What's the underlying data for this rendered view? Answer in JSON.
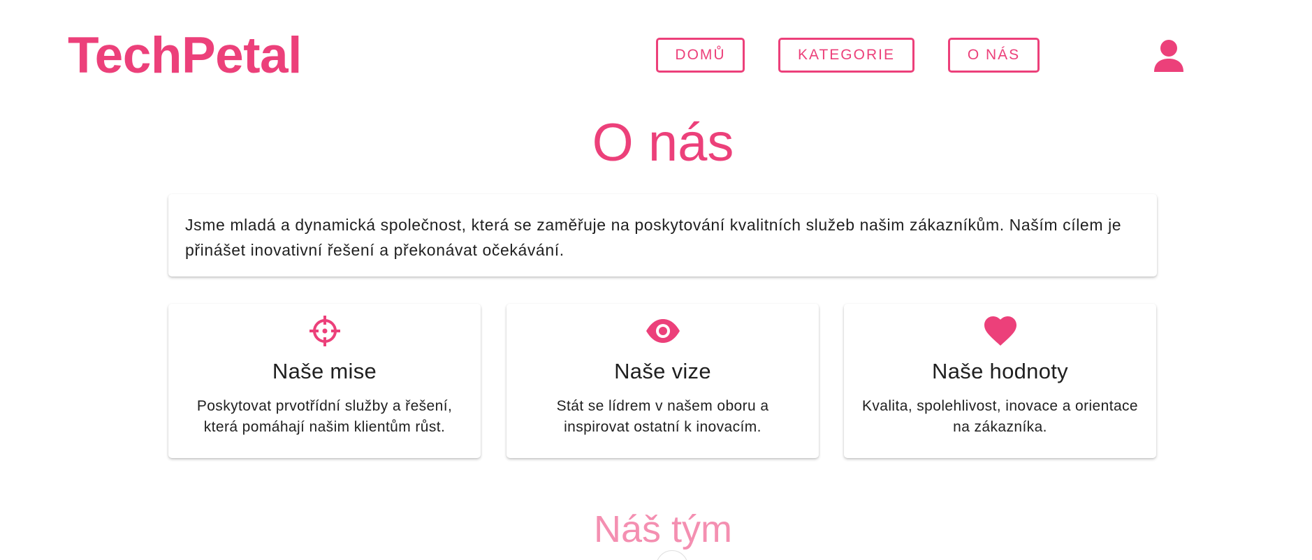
{
  "header": {
    "logo": "TechPetal",
    "nav": {
      "home": "DOMŮ",
      "categories": "KATEGORIE",
      "about": "O NÁS"
    },
    "user_icon": "account-icon"
  },
  "main": {
    "title": "O nás",
    "intro": "Jsme mladá a dynamická společnost, která se zaměřuje na poskytování kvalitních služeb našim zákazníkům. Naším cílem je přinášet inovativní řešení a překonávat očekávání.",
    "features": [
      {
        "icon": "crosshair-icon",
        "title": "Naše mise",
        "description": "Poskytovat prvotřídní služby a řešení, která pomáhají našim klientům růst."
      },
      {
        "icon": "eye-icon",
        "title": "Naše vize",
        "description": "Stát se lídrem v našem oboru a inspirovat ostatní k inovacím."
      },
      {
        "icon": "heart-icon",
        "title": "Naše hodnoty",
        "description": "Kvalita, spolehlivost, inovace a orientace na zákazníka."
      }
    ],
    "team_title": "Náš tým"
  },
  "colors": {
    "accent": "#ec407a",
    "accent_light": "#f48fb1",
    "text": "#1f1f1f",
    "background": "#ffffff"
  }
}
